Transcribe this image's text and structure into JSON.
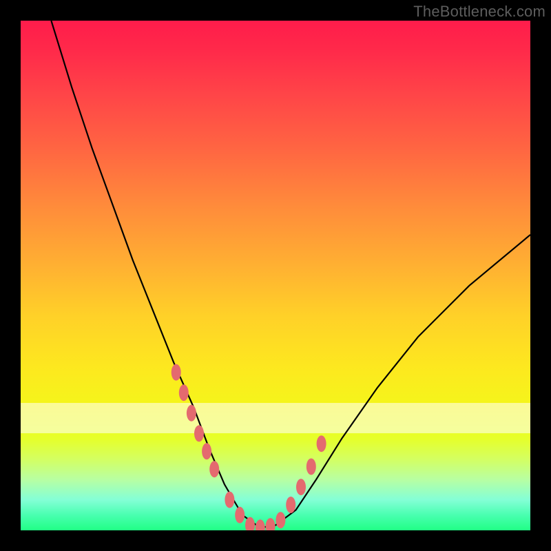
{
  "watermark": {
    "text": "TheBottleneck.com"
  },
  "colors": {
    "frame": "#000000",
    "curve": "#000000",
    "marker": "#e46a6f",
    "gradient_top": "#ff1c4b",
    "gradient_bottom": "#21ff85"
  },
  "chart_data": {
    "type": "line",
    "title": "",
    "xlabel": "",
    "ylabel": "",
    "xlim": [
      0,
      100
    ],
    "ylim": [
      0,
      100
    ],
    "grid": false,
    "legend": false,
    "notes": "V-shaped bottleneck curve over a red→green vertical gradient. Lower y (vertically lower on image) = better / green. Pink markers cluster near the bottom of the V.",
    "series": [
      {
        "name": "bottleneck-curve",
        "x": [
          6,
          10,
          14,
          18,
          22,
          26,
          30,
          34,
          37,
          40,
          43.5,
          47,
          50,
          54,
          58,
          63,
          70,
          78,
          88,
          100
        ],
        "y": [
          100,
          87,
          75,
          64,
          53,
          43,
          33,
          24,
          16,
          9,
          3,
          0.5,
          1,
          4,
          10,
          18,
          28,
          38,
          48,
          58
        ]
      }
    ],
    "markers": {
      "name": "highlighted-points",
      "x": [
        30.5,
        32,
        33.5,
        35,
        36.5,
        38,
        41,
        43,
        45,
        47,
        49,
        51,
        53,
        55,
        57,
        59
      ],
      "y": [
        31,
        27,
        23,
        19,
        15.5,
        12,
        6,
        3,
        1,
        0.5,
        0.8,
        2,
        5,
        8.5,
        12.5,
        17
      ]
    },
    "bands": [
      {
        "y_from": 19,
        "y_to": 25,
        "alpha": 0.55
      }
    ]
  }
}
